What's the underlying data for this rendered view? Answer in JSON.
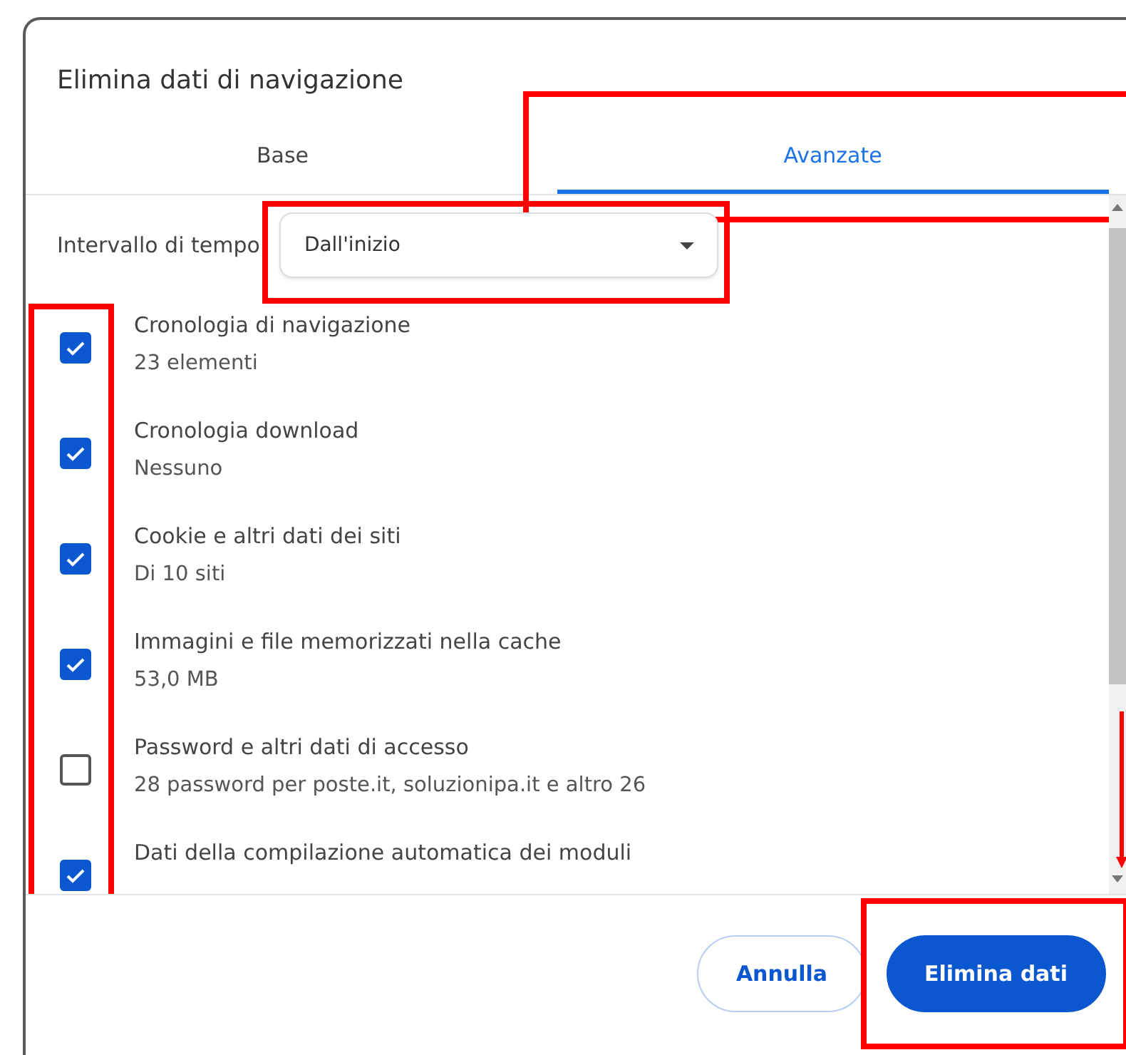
{
  "dialog": {
    "title": "Elimina dati di navigazione"
  },
  "tabs": [
    {
      "label": "Base",
      "selected": false,
      "highlighted": false
    },
    {
      "label": "Avanzate",
      "selected": true,
      "highlighted": true
    }
  ],
  "time_range": {
    "label": "Intervallo di tempo",
    "value": "Dall'inizio",
    "highlighted": true
  },
  "checkboxes_highlighted": true,
  "items": [
    {
      "title": "Cronologia di navigazione",
      "detail": "23 elementi",
      "checked": true
    },
    {
      "title": "Cronologia download",
      "detail": "Nessuno",
      "checked": true
    },
    {
      "title": "Cookie e altri dati dei siti",
      "detail": "Di 10 siti",
      "checked": true
    },
    {
      "title": "Immagini e file memorizzati nella cache",
      "detail": "53,0 MB",
      "checked": true
    },
    {
      "title": "Password e altri dati di accesso",
      "detail": "28 password per poste.it, soluzionipa.it e altro 26",
      "checked": false
    },
    {
      "title": "Dati della compilazione automatica dei moduli",
      "checked": true
    }
  ],
  "buttons": [
    {
      "label": "Annulla",
      "kind": "secondary",
      "highlighted": false
    },
    {
      "label": "Elimina dati",
      "kind": "primary",
      "highlighted": true
    }
  ]
}
